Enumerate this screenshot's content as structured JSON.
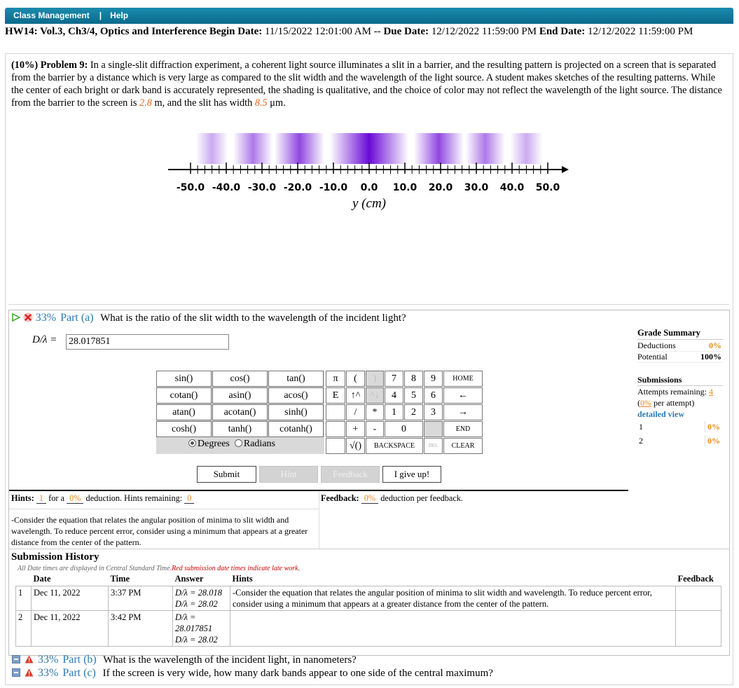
{
  "nav": {
    "class_management": "Class Management",
    "sep": "|",
    "help": "Help"
  },
  "hw": {
    "title": "HW14: Vol.3, Ch3/4, Optics and Interference",
    "begin_label": "Begin Date:",
    "begin_date": "11/15/2022 12:01:00 AM",
    "dash": "--",
    "due_label": "Due Date:",
    "due_date": "12/12/2022 11:59:00 PM",
    "end_label": "End Date:",
    "end_date": "12/12/2022 11:59:00 PM"
  },
  "problem": {
    "weight": "(10%)",
    "label": "Problem 9:",
    "text_1": "In a single-slit diffraction experiment, a coherent light source illuminates a slit in a barrier, and the resulting pattern is projected on a screen that is separated from the barrier by a distance which is very large as compared to the slit width and the wavelength of the light source. A student makes sketches of the resulting patterns. While the center of each bright or dark band is accurately represented, the shading is qualitative, and the choice of color may not reflect the wavelength of the light source. The distance from the barrier to the screen is",
    "distance": "2.8",
    "text_2": "m, and the slit has width",
    "width": "8.5",
    "text_3": "μm."
  },
  "figure": {
    "tick_labels": [
      "-50.0",
      "-40.0",
      "-30.0",
      "-20.0",
      "-10.0",
      "0.0",
      "10.0",
      "20.0",
      "30.0",
      "40.0",
      "50.0"
    ],
    "axis_label": "y (cm)",
    "band_color": "#6a0ad6"
  },
  "part_a": {
    "percent": "33%",
    "label": "Part (a)",
    "question": "What is the ratio of the slit width to the wavelength of the incident light?",
    "var": "D/λ =",
    "answer": "28.017851"
  },
  "fnkeys": [
    "sin()",
    "cos()",
    "tan()",
    "cotan()",
    "asin()",
    "acos()",
    "atan()",
    "acotan()",
    "sinh()",
    "cosh()",
    "tanh()",
    "cotanh()"
  ],
  "angle": {
    "degrees": "Degrees",
    "radians": "Radians"
  },
  "numkeys": {
    "pi": "π",
    "lparen": "(",
    "rparen": ")",
    "seven": "7",
    "eight": "8",
    "nine": "9",
    "home": "HOME",
    "e": "E",
    "up": "↑^",
    "updis": "^↓",
    "four": "4",
    "five": "5",
    "six": "6",
    "left": "←",
    "slash": "/",
    "star": "*",
    "one": "1",
    "two": "2",
    "three": "3",
    "right": "→",
    "plus": "+",
    "minus": "-",
    "zero": "0",
    "end": "END",
    "sqrt": "√()",
    "backspace": "BACKSPACE",
    "del": "DEL",
    "clear": "CLEAR"
  },
  "actions": {
    "submit": "Submit",
    "hint": "Hint",
    "feedback": "Feedback",
    "give_up": "I give up!"
  },
  "hints": {
    "label": "Hints:",
    "count": "1",
    "for_a": "for a",
    "deduction": "0%",
    "deduction_text": "deduction. Hints remaining:",
    "remaining": "0",
    "text": "-Consider the equation that relates the angular position of minima to slit width and wavelength. To reduce percent error, consider using a minimum that appears at a greater distance from the center of the pattern."
  },
  "feedback": {
    "label": "Feedback:",
    "pct": "0%",
    "text": "deduction per feedback."
  },
  "grade": {
    "title": "Grade Summary",
    "deductions_label": "Deductions",
    "deductions": "0%",
    "potential_label": "Potential",
    "potential": "100%"
  },
  "submissions": {
    "title": "Submissions",
    "attempts_label": "Attempts remaining:",
    "attempts": "4",
    "per_attempt_pct": "0%",
    "per_attempt": "per attempt)",
    "detailed": "detailed view",
    "rows": [
      {
        "n": "1",
        "v": "0%"
      },
      {
        "n": "2",
        "v": "0%"
      }
    ]
  },
  "history": {
    "title": "Submission History",
    "note": "All Date times are displayed in Central Standard Time.",
    "note_red": "Red submission date times indicate late work.",
    "headers": {
      "date": "Date",
      "time": "Time",
      "answer": "Answer",
      "hints": "Hints",
      "feedback": "Feedback"
    },
    "rows": [
      {
        "n": "1",
        "date": "Dec 11, 2022",
        "time": "3:37 PM",
        "answer_1": "D/λ = 28.018",
        "answer_2": "D/λ = 28.02",
        "hints": "-Consider the equation that relates the angular position of minima to slit width and wavelength. To reduce percent error, consider using a minimum that appears at a greater distance from the center of the pattern."
      },
      {
        "n": "2",
        "date": "Dec 11, 2022",
        "time": "3:42 PM",
        "answer_1": "D/λ = 28.017851",
        "answer_2": "D/λ = 28.02",
        "hints": ""
      }
    ]
  },
  "part_b": {
    "percent": "33%",
    "label": "Part (b)",
    "question": "What is the wavelength of the incident light, in nanometers?"
  },
  "part_c": {
    "percent": "33%",
    "label": "Part (c)",
    "question": "If the screen is very wide, how many dark bands appear to one side of the central maximum?"
  }
}
